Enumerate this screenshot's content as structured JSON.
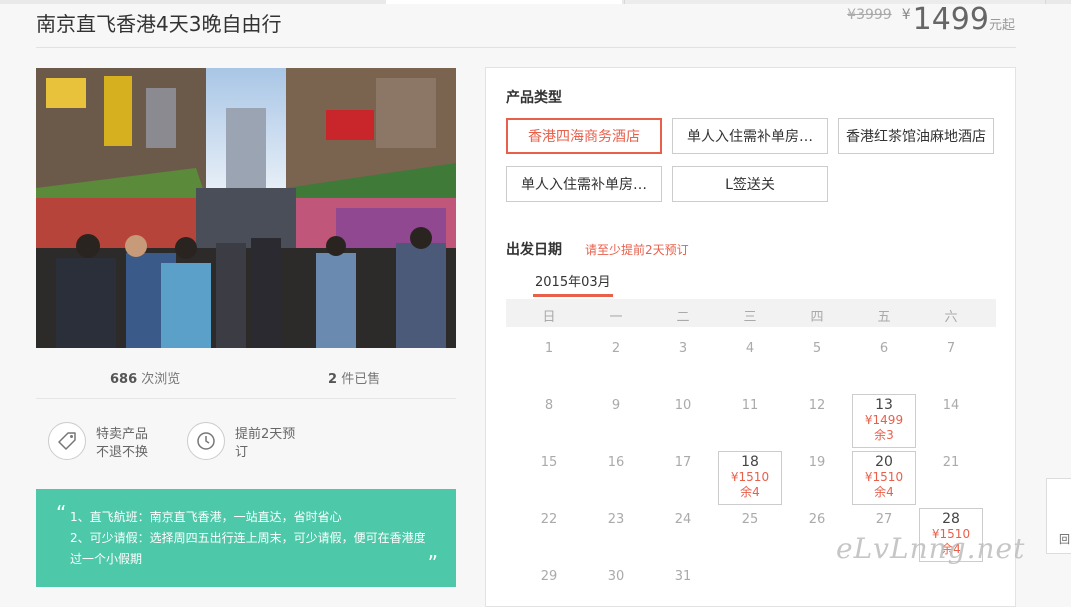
{
  "product": {
    "title": "南京直飞香港4天3晚自由行",
    "old_price": "¥3999",
    "currency": "¥",
    "price": "1499",
    "price_unit": "元起"
  },
  "stats": {
    "views_count": "686",
    "views_label": "次浏览",
    "sold_count": "2",
    "sold_label": "件已售"
  },
  "features": [
    {
      "icon": "price-tag-icon",
      "text": "特卖产品不退不换"
    },
    {
      "icon": "clock-icon",
      "text": "提前2天预订"
    }
  ],
  "note": {
    "line1": "1、直飞航班：南京直飞香港，一站直达，省时省心",
    "line2": "2、可少请假：选择周四五出行连上周末，可少请假，便可在香港度过一个小假期"
  },
  "booking": {
    "product_type_title": "产品类型",
    "product_types": [
      {
        "label": "香港四海商务酒店",
        "selected": true
      },
      {
        "label": "单人入住需补单房…",
        "selected": false
      },
      {
        "label": "香港红茶馆油麻地酒店",
        "selected": false
      },
      {
        "label": "单人入住需补单房…",
        "selected": false
      },
      {
        "label": "L签送关",
        "selected": false
      }
    ],
    "date_title": "出发日期",
    "date_hint": "请至少提前2天预订",
    "month_label": "2015年03月",
    "weekdays": [
      "日",
      "一",
      "二",
      "三",
      "四",
      "五",
      "六"
    ],
    "days": [
      {
        "day": "1"
      },
      {
        "day": "2"
      },
      {
        "day": "3"
      },
      {
        "day": "4"
      },
      {
        "day": "5"
      },
      {
        "day": "6"
      },
      {
        "day": "7"
      },
      {
        "day": "8"
      },
      {
        "day": "9"
      },
      {
        "day": "10"
      },
      {
        "day": "11"
      },
      {
        "day": "12"
      },
      {
        "day": "13",
        "price": "¥1499",
        "left": "余3"
      },
      {
        "day": "14"
      },
      {
        "day": "15"
      },
      {
        "day": "16"
      },
      {
        "day": "17"
      },
      {
        "day": "18",
        "price": "¥1510",
        "left": "余4"
      },
      {
        "day": "19"
      },
      {
        "day": "20",
        "price": "¥1510",
        "left": "余4"
      },
      {
        "day": "21"
      },
      {
        "day": "22"
      },
      {
        "day": "23"
      },
      {
        "day": "24"
      },
      {
        "day": "25"
      },
      {
        "day": "26"
      },
      {
        "day": "27"
      },
      {
        "day": "28",
        "price": "¥1510",
        "left": "余4"
      },
      {
        "day": "29"
      },
      {
        "day": "30"
      },
      {
        "day": "31"
      }
    ]
  },
  "side": {
    "back_label": "回"
  },
  "watermark": "eLvLnng.net",
  "colors": {
    "accent": "#e8604c",
    "note_bg": "#4dc8a9"
  }
}
